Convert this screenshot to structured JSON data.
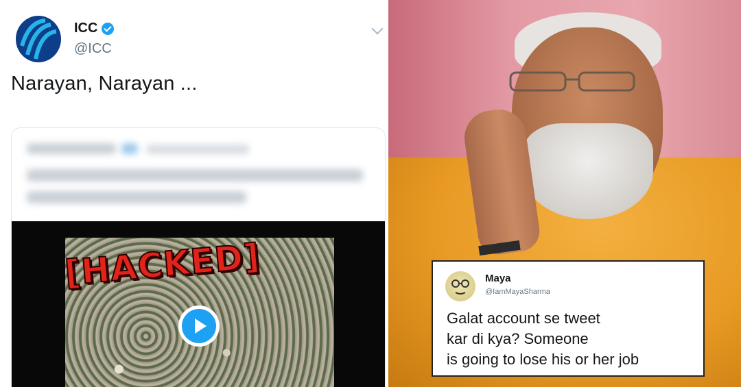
{
  "tweet": {
    "name": "ICC",
    "handle": "@ICC",
    "text": "Narayan, Narayan ...",
    "embedded_overlay": "[HACKED]"
  },
  "reply": {
    "name": "Maya",
    "handle": "@IamMayaSharma",
    "lines": [
      "Galat account se tweet",
      "kar di kya? Someone",
      "is going to lose his or her  job"
    ]
  },
  "colors": {
    "twitter_blue": "#1da1f2",
    "hacked_red": "#e2231a"
  }
}
